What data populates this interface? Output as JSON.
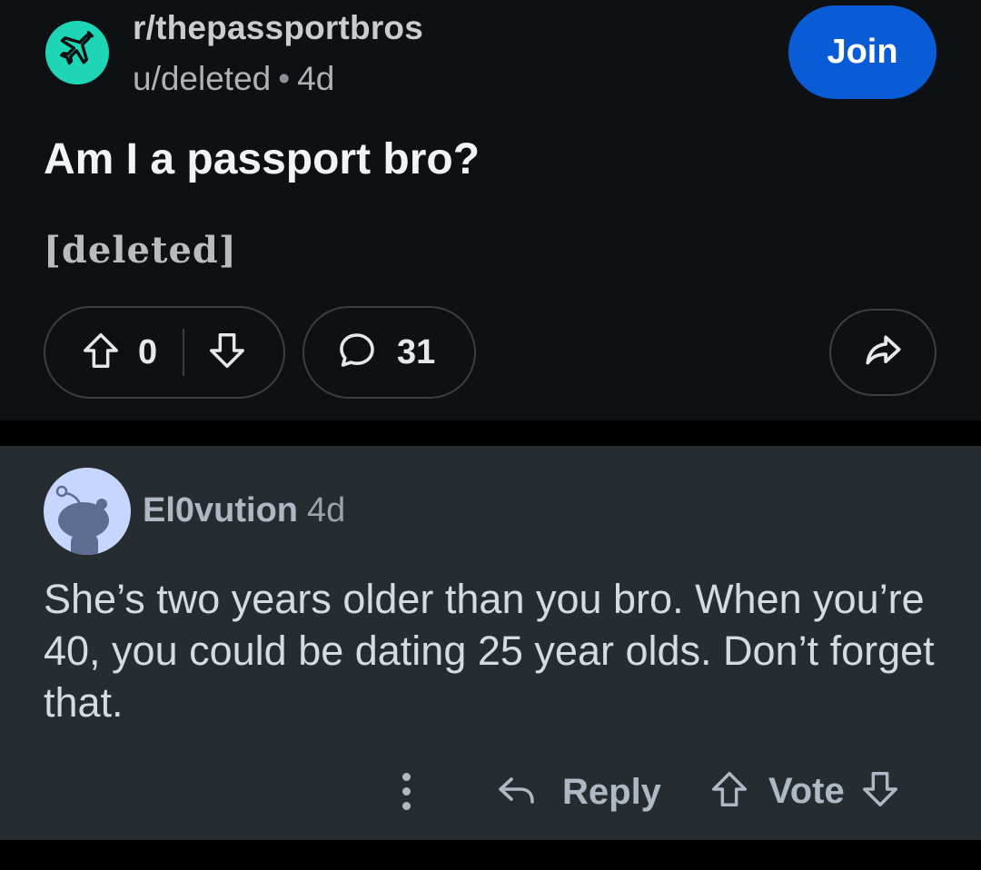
{
  "post": {
    "subreddit": "r/thepassportbros",
    "author": "u/deleted",
    "separator": "•",
    "age": "4d",
    "join_label": "Join",
    "title": "Am I a passport bro?",
    "body": "[deleted]",
    "score": "0",
    "comment_count": "31",
    "icons": {
      "subreddit": "airplane-icon",
      "upvote": "arrow-up-icon",
      "downvote": "arrow-down-icon",
      "comments": "speech-bubble-icon",
      "share": "share-arrow-icon"
    }
  },
  "comment": {
    "author": "El0vution",
    "age": "4d",
    "text": "She’s two years older than you bro. When you’re 40, you could be dating 25 year olds. Don’t forget that.",
    "reply_label": "Reply",
    "vote_label": "Vote",
    "icons": {
      "more": "more-vertical-icon",
      "reply": "reply-arrow-icon",
      "upvote": "arrow-up-icon",
      "downvote": "arrow-down-icon"
    }
  },
  "colors": {
    "post_background": "#0e1113",
    "comment_background": "#272c30",
    "join_button": "#0a5cd6",
    "subreddit_icon": "#1ed6b6",
    "user_avatar": "#c7d6ff"
  }
}
